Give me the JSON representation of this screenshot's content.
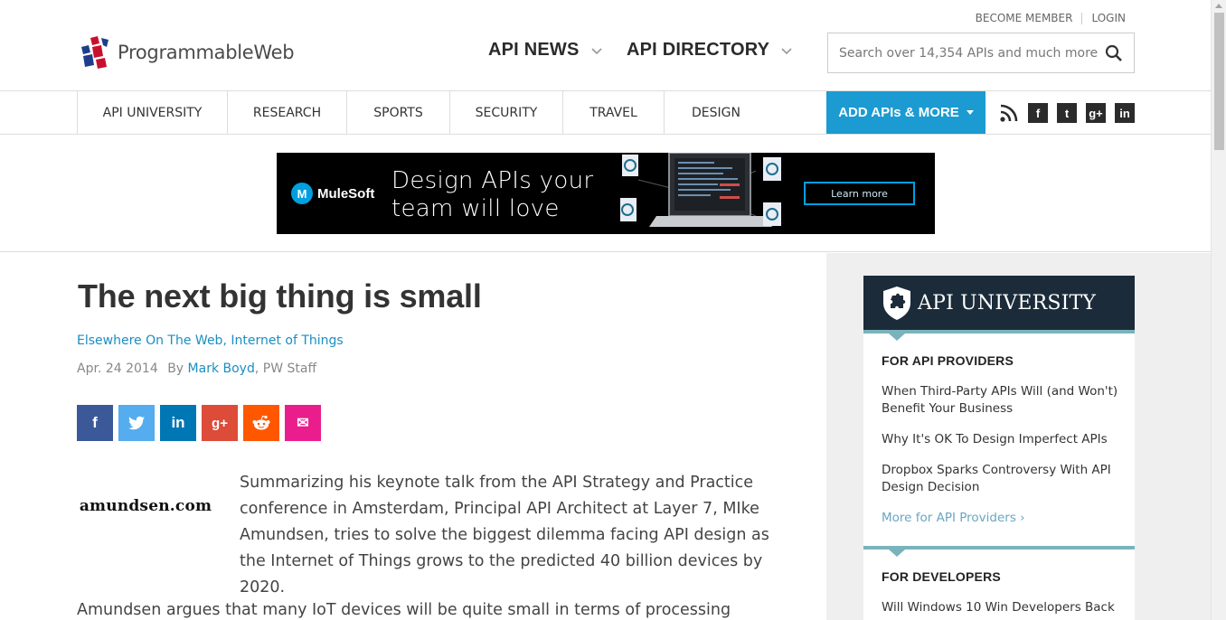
{
  "header": {
    "logo_text": "ProgrammableWeb",
    "top_links": [
      "BECOME MEMBER",
      "LOGIN"
    ],
    "nav_big": [
      "API NEWS",
      "API DIRECTORY"
    ],
    "search_placeholder": "Search over 14,354 APIs and much more"
  },
  "navbar": {
    "items": [
      "API UNIVERSITY",
      "RESEARCH",
      "SPORTS",
      "SECURITY",
      "TRAVEL",
      "DESIGN"
    ],
    "add_button": "ADD APIs & MORE",
    "social_icons": [
      "rss-icon",
      "facebook-icon",
      "twitter-icon",
      "google-plus-icon",
      "linkedin-icon"
    ]
  },
  "ad": {
    "brand": "MuleSoft",
    "headline_line1": "Design APIs your",
    "headline_line2": "team will love",
    "cta": "Learn more"
  },
  "article": {
    "title": "The next big thing is small",
    "category1": "Elsewhere On The Web",
    "category_sep": ", ",
    "category2": "Internet of Things",
    "date": "Apr. 24 2014",
    "by": "By",
    "author": "Mark Boyd",
    "author_role": ", PW Staff",
    "share_buttons": [
      {
        "icon": "facebook-icon",
        "glyph": "f",
        "color": "#3b5998"
      },
      {
        "icon": "twitter-icon",
        "glyph": "t",
        "color": "#55acee"
      },
      {
        "icon": "linkedin-icon",
        "glyph": "in",
        "color": "#0077b5"
      },
      {
        "icon": "google-plus-icon",
        "glyph": "g+",
        "color": "#dd4b39"
      },
      {
        "icon": "reddit-icon",
        "glyph": "r",
        "color": "#ff5700"
      },
      {
        "icon": "email-icon",
        "glyph": "✉",
        "color": "#e91e8c"
      }
    ],
    "thumb_text": "amundsen.com",
    "intro": "Summarizing his keynote talk from the API Strategy and Practice conference in Amsterdam, Principal API Architect at Layer 7, MIke Amundsen, tries to solve the biggest dilemma facing API design as the Internet of Things grows to the predicted 40 billion devices by 2020.",
    "para2": "Amundsen argues that many IoT devices will be quite small in terms of processing"
  },
  "sidebar": {
    "title": "API UNIVERSITY",
    "section1": {
      "heading": "FOR API PROVIDERS",
      "links": [
        "When Third-Party APIs Will (and Won't) Benefit Your Business",
        "Why It's OK To Design Imperfect APIs",
        "Dropbox Sparks Controversy With API Design Decision"
      ],
      "more": "More for API Providers ›"
    },
    "section2": {
      "heading": "FOR DEVELOPERS",
      "links": [
        "Will Windows 10 Win Developers Back"
      ]
    }
  }
}
